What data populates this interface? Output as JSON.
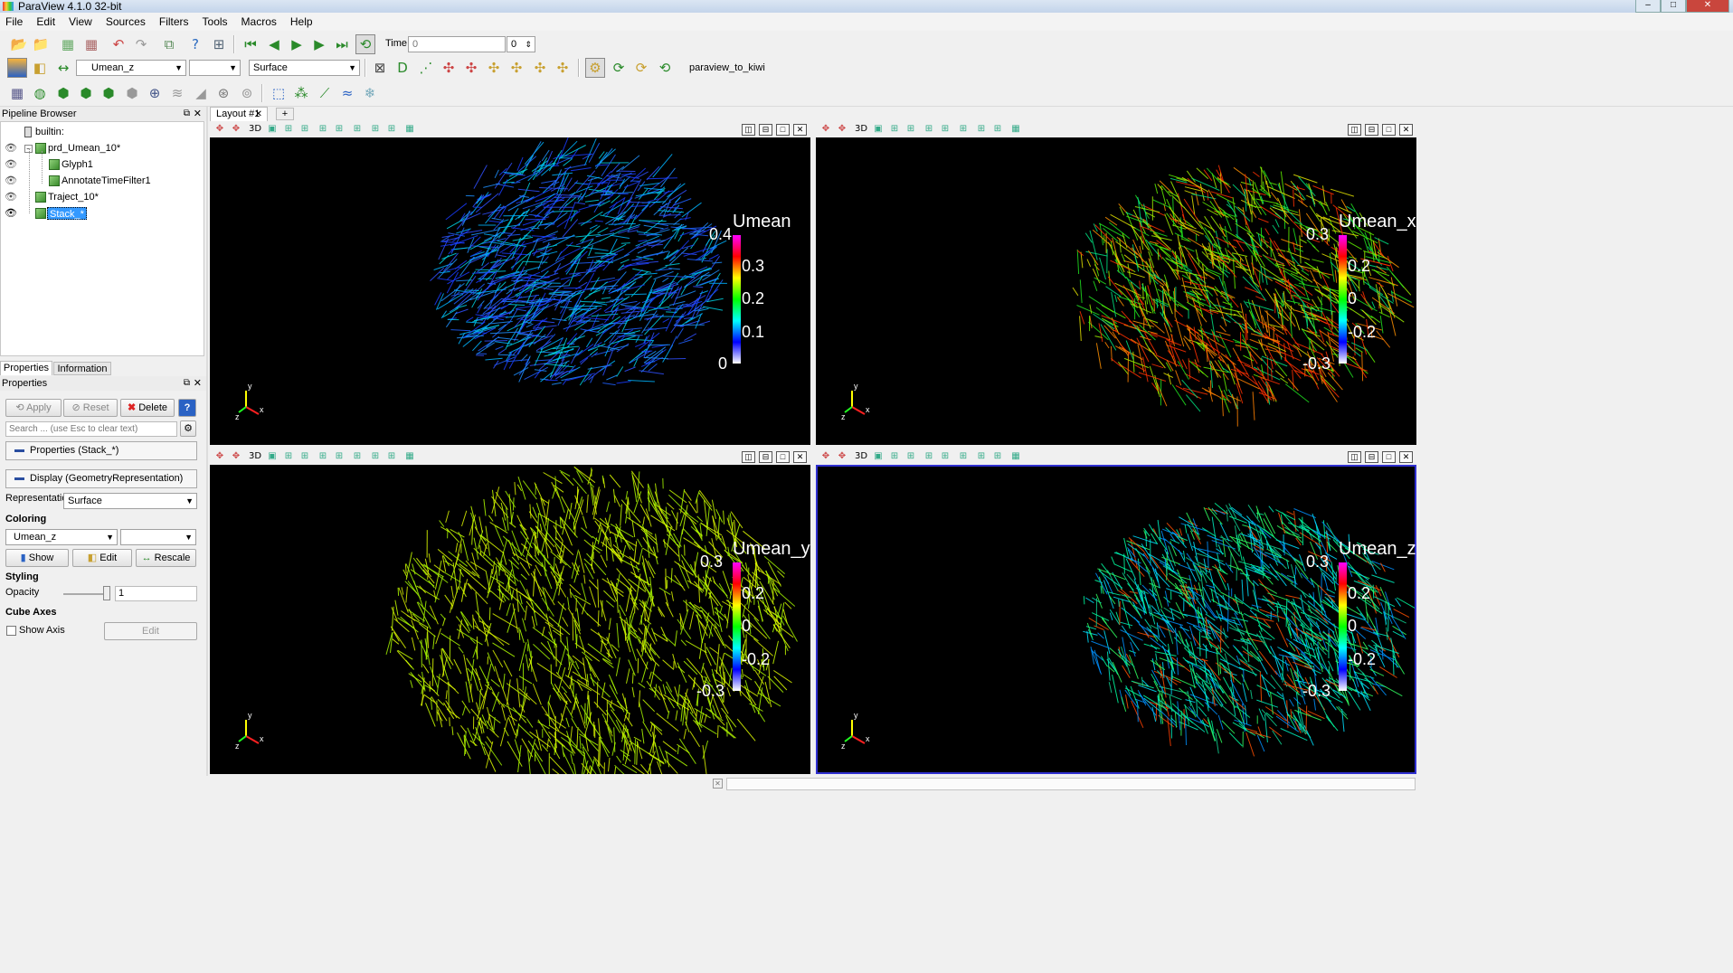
{
  "window": {
    "title": "ParaView 4.1.0 32-bit"
  },
  "menu": [
    "File",
    "Edit",
    "View",
    "Sources",
    "Filters",
    "Tools",
    "Macros",
    "Help"
  ],
  "toolbar": {
    "time_label": "Time:",
    "time_value": "0",
    "time_index": "0",
    "color_array": "Umean_z",
    "component": "",
    "representation": "Surface",
    "macro": "paraview_to_kiwi"
  },
  "pipeline": {
    "title": "Pipeline Browser",
    "items": [
      {
        "label": "builtin:"
      },
      {
        "label": "prd_Umean_10*"
      },
      {
        "label": "Glyph1"
      },
      {
        "label": "AnnotateTimeFilter1"
      },
      {
        "label": "Traject_10*"
      },
      {
        "label": "Stack_*"
      }
    ]
  },
  "tabs": {
    "properties": "Properties",
    "information": "Information"
  },
  "properties": {
    "title": "Properties",
    "apply": "Apply",
    "reset": "Reset",
    "delete": "Delete",
    "help": "?",
    "search_placeholder": "Search ... (use Esc to clear text)",
    "section_props": "Properties (Stack_*)",
    "section_display": "Display (GeometryRepresentation)",
    "representation_label": "Representation",
    "representation_value": "Surface",
    "coloring": "Coloring",
    "color_array": "Umean_z",
    "color_component": "",
    "show": "Show",
    "edit": "Edit",
    "rescale": "Rescale",
    "styling": "Styling",
    "opacity_label": "Opacity",
    "opacity_value": "1",
    "opacity_fraction": 1.0,
    "cube_axes": "Cube Axes",
    "show_axis": "Show Axis",
    "edit_axis": "Edit"
  },
  "layout_tab": "Layout #1",
  "add_tab": "+",
  "view_mode_label": "3D",
  "views": [
    {
      "scalar": "Umean",
      "ticks": [
        "0.4",
        "0.3",
        "0.2",
        "0.1",
        "0"
      ],
      "palette": "blue"
    },
    {
      "scalar": "Umean_x",
      "ticks": [
        "0.3",
        "0.2",
        "0",
        "-0.2",
        "-0.3"
      ],
      "palette": "greenred"
    },
    {
      "scalar": "Umean_y",
      "ticks": [
        "0.3",
        "0.2",
        "0",
        "-0.2",
        "-0.3"
      ],
      "palette": "yellow"
    },
    {
      "scalar": "Umean_z",
      "ticks": [
        "0.3",
        "0.2",
        "0",
        "-0.2",
        "-0.3"
      ],
      "palette": "cyan"
    }
  ],
  "axes_labels": {
    "x": "x",
    "y": "y",
    "z": "z"
  },
  "colors": {
    "view_bg": "#000000",
    "active_border": "#3030d0",
    "colormap": [
      "#ff00ff",
      "#ff0000",
      "#ffff00",
      "#00ff00",
      "#00ffff",
      "#0000ff",
      "#ffffff"
    ]
  }
}
